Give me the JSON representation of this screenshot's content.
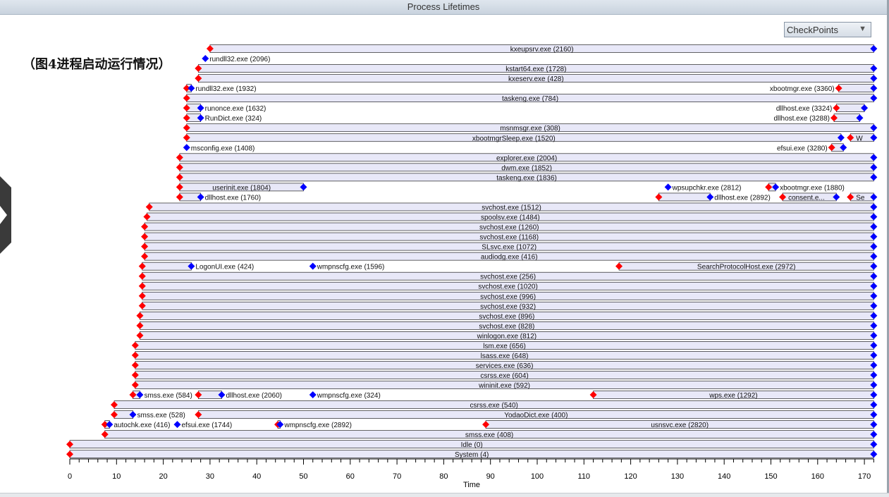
{
  "window": {
    "title": "Process Lifetimes"
  },
  "dropdown": {
    "label": "CheckPoints"
  },
  "caption": "（图4进程启动运行情况）",
  "chart_data": {
    "type": "gantt",
    "xlabel": "Time",
    "xlim": [
      0,
      172
    ],
    "ticks": [
      0,
      10,
      20,
      30,
      40,
      50,
      60,
      70,
      80,
      90,
      100,
      110,
      120,
      130,
      140,
      150,
      160,
      170
    ],
    "colors": {
      "start_marker": "#ff0000",
      "end_marker": "#0000ff",
      "bar_fill": "#e8e8f8",
      "bar_stroke": "#000000"
    },
    "rows": [
      [
        {
          "label": "kxeupsrv.exe (2160)",
          "start": 30,
          "end": 172,
          "pos": "center"
        }
      ],
      [
        {
          "label": "rundll32.exe (2096)",
          "start": null,
          "end": 29,
          "pos": "right"
        }
      ],
      [
        {
          "label": "kstart64.exe (1728)",
          "start": 27.5,
          "end": 172,
          "pos": "center"
        }
      ],
      [
        {
          "label": "kxeserv.exe (428)",
          "start": 27.5,
          "end": 172,
          "pos": "center"
        }
      ],
      [
        {
          "label": "rundll32.exe (1932)",
          "start": 25,
          "end": 26,
          "pos": "right"
        },
        {
          "label": "xbootmgr.exe (3360)",
          "start": 164.5,
          "end": 172,
          "pos": "left"
        }
      ],
      [
        {
          "label": "taskeng.exe (784)",
          "start": 25,
          "end": 172,
          "pos": "center"
        }
      ],
      [
        {
          "label": "runonce.exe (1632)",
          "start": 25,
          "end": 28,
          "pos": "right"
        },
        {
          "label": "dllhost.exe (3324)",
          "start": 164,
          "end": 170,
          "pos": "left"
        }
      ],
      [
        {
          "label": "RunDict.exe (324)",
          "start": 25,
          "end": 28,
          "pos": "right"
        },
        {
          "label": "dllhost.exe (3288)",
          "start": 163.5,
          "end": 169,
          "pos": "left"
        }
      ],
      [
        {
          "label": "msnmsgr.exe (308)",
          "start": 25,
          "end": 172,
          "pos": "center"
        }
      ],
      [
        {
          "label": "xbootmgrSleep.exe (1520)",
          "start": 25,
          "end": 165,
          "pos": "center"
        },
        {
          "label": "W",
          "start": 167,
          "end": 172,
          "pos": "inside"
        }
      ],
      [
        {
          "label": "msconfig.exe (1408)",
          "start": null,
          "end": 25,
          "pos": "right"
        },
        {
          "label": "efsui.exe (3280)",
          "start": 163,
          "end": 165.5,
          "pos": "left"
        }
      ],
      [
        {
          "label": "explorer.exe (2004)",
          "start": 23.5,
          "end": 172,
          "pos": "center"
        }
      ],
      [
        {
          "label": "dwm.exe (1852)",
          "start": 23.5,
          "end": 172,
          "pos": "center"
        }
      ],
      [
        {
          "label": "taskeng.exe (1836)",
          "start": 23.5,
          "end": 172,
          "pos": "center"
        }
      ],
      [
        {
          "label": "userinit.exe (1804)",
          "start": 23.5,
          "end": 50,
          "pos": "center"
        },
        {
          "label": "wpsupchkr.exe (2812)",
          "start": null,
          "end": 128,
          "pos": "right"
        },
        {
          "label": "xbootmgr.exe (1880)",
          "start": 149.5,
          "end": 151,
          "pos": "right"
        }
      ],
      [
        {
          "label": "dllhost.exe (1760)",
          "start": 23.5,
          "end": 28,
          "pos": "right"
        },
        {
          "label": "dllhost.exe (2892)",
          "start": 126,
          "end": 137,
          "pos": "right"
        },
        {
          "label": "consent.e...",
          "start": 152.5,
          "end": 164,
          "pos": "inside"
        },
        {
          "label": "Se",
          "start": 167,
          "end": 172,
          "pos": "inside"
        }
      ],
      [
        {
          "label": "svchost.exe (1512)",
          "start": 17,
          "end": 172,
          "pos": "center"
        }
      ],
      [
        {
          "label": "spoolsv.exe (1484)",
          "start": 16.5,
          "end": 172,
          "pos": "center"
        }
      ],
      [
        {
          "label": "svchost.exe (1260)",
          "start": 16,
          "end": 172,
          "pos": "center"
        }
      ],
      [
        {
          "label": "svchost.exe (1168)",
          "start": 16,
          "end": 172,
          "pos": "center"
        }
      ],
      [
        {
          "label": "SLsvc.exe (1072)",
          "start": 16,
          "end": 172,
          "pos": "center"
        }
      ],
      [
        {
          "label": "audiodg.exe (416)",
          "start": 16,
          "end": 172,
          "pos": "center"
        }
      ],
      [
        {
          "label": "LogonUI.exe (424)",
          "start": 15.5,
          "end": 26,
          "pos": "right"
        },
        {
          "label": "wmpnscfg.exe (1596)",
          "start": null,
          "end": 52,
          "pos": "right"
        },
        {
          "label": "SearchProtocolHost.exe (2972)",
          "start": 117.5,
          "end": 172,
          "pos": "center"
        }
      ],
      [
        {
          "label": "svchost.exe (256)",
          "start": 15.5,
          "end": 172,
          "pos": "center"
        }
      ],
      [
        {
          "label": "svchost.exe (1020)",
          "start": 15.5,
          "end": 172,
          "pos": "center"
        }
      ],
      [
        {
          "label": "svchost.exe (996)",
          "start": 15.5,
          "end": 172,
          "pos": "center"
        }
      ],
      [
        {
          "label": "svchost.exe (932)",
          "start": 15.5,
          "end": 172,
          "pos": "center"
        }
      ],
      [
        {
          "label": "svchost.exe (896)",
          "start": 15,
          "end": 172,
          "pos": "center"
        }
      ],
      [
        {
          "label": "svchost.exe (828)",
          "start": 15,
          "end": 172,
          "pos": "center"
        }
      ],
      [
        {
          "label": "winlogon.exe (812)",
          "start": 15,
          "end": 172,
          "pos": "center"
        }
      ],
      [
        {
          "label": "lsm.exe (656)",
          "start": 14,
          "end": 172,
          "pos": "center"
        }
      ],
      [
        {
          "label": "lsass.exe (648)",
          "start": 14,
          "end": 172,
          "pos": "center"
        }
      ],
      [
        {
          "label": "services.exe (636)",
          "start": 14,
          "end": 172,
          "pos": "center"
        }
      ],
      [
        {
          "label": "csrss.exe (604)",
          "start": 14,
          "end": 172,
          "pos": "center"
        }
      ],
      [
        {
          "label": "wininit.exe (592)",
          "start": 14,
          "end": 172,
          "pos": "center"
        }
      ],
      [
        {
          "label": "smss.exe (584)",
          "start": 13.5,
          "end": 15,
          "pos": "right"
        },
        {
          "label": "dllhost.exe (2060)",
          "start": 27.5,
          "end": 32.5,
          "pos": "right"
        },
        {
          "label": "wmpnscfg.exe (324)",
          "start": null,
          "end": 52,
          "pos": "right"
        },
        {
          "label": "wps.exe (1292)",
          "start": 112,
          "end": 172,
          "pos": "center"
        }
      ],
      [
        {
          "label": "csrss.exe (540)",
          "start": 9.5,
          "end": 172,
          "pos": "center"
        }
      ],
      [
        {
          "label": "smss.exe (528)",
          "start": 9.5,
          "end": 13.5,
          "pos": "right"
        },
        {
          "label": "YodaoDict.exe (400)",
          "start": 27.5,
          "end": 172,
          "pos": "center"
        }
      ],
      [
        {
          "label": "autochk.exe (416)",
          "start": 7.5,
          "end": 8.5,
          "pos": "right"
        },
        {
          "label": "efsui.exe (1744)",
          "start": null,
          "end": 23,
          "pos": "right"
        },
        {
          "label": "wmpnscfg.exe (2892)",
          "start": 44.5,
          "end": 45,
          "pos": "right"
        },
        {
          "label": "usnsvc.exe (2820)",
          "start": 89,
          "end": 172,
          "pos": "center"
        }
      ],
      [
        {
          "label": "smss.exe (408)",
          "start": 7.5,
          "end": 172,
          "pos": "center"
        }
      ],
      [
        {
          "label": "Idle (0)",
          "start": 0,
          "end": 172,
          "pos": "center"
        }
      ],
      [
        {
          "label": "System (4)",
          "start": 0,
          "end": 172,
          "pos": "center"
        }
      ]
    ]
  }
}
